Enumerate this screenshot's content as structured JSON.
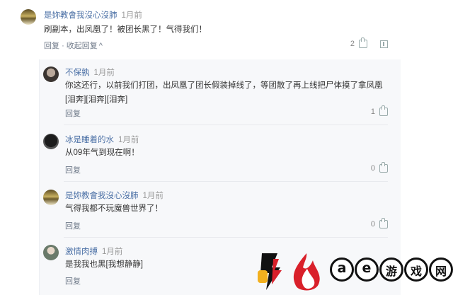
{
  "comment": {
    "user": "是妳教會我沒心沒肺",
    "time": "1月前",
    "text": "刷副本，出凤凰了！被团长黑了！气得我们！",
    "reply_label": "回复",
    "dot": "·",
    "collapse_label": "收起回复",
    "collapse_arrow": "^",
    "likes": "2"
  },
  "replies": [
    {
      "user": "不保孰",
      "time": "1月前",
      "text": "你这还行，以前我们打团，出凤凰了团长假装掉线了，等团散了再上线把尸体摸了拿凤凰[泪奔][泪奔][泪奔]",
      "reply_label": "回复",
      "likes": "1"
    },
    {
      "user": "冰是睡着的水",
      "time": "1月前",
      "text": "从09年气到现在啊！",
      "reply_label": "回复",
      "likes": "0"
    },
    {
      "user": "是妳教會我沒心沒肺",
      "time": "1月前",
      "text": "气得我都不玩魔兽世界了！",
      "reply_label": "回复",
      "likes": "0"
    },
    {
      "user": "激情肉搏",
      "time": "1月前",
      "text": "是我我也黑[我想静静]",
      "reply_label": "回复",
      "likes": ""
    }
  ],
  "watermark": {
    "letters": [
      "a",
      "e",
      "游",
      "戏",
      "网"
    ]
  },
  "colors": {
    "username": "#4a6fa5",
    "meta": "#999999",
    "subbox_bg": "#f7f8fa"
  }
}
